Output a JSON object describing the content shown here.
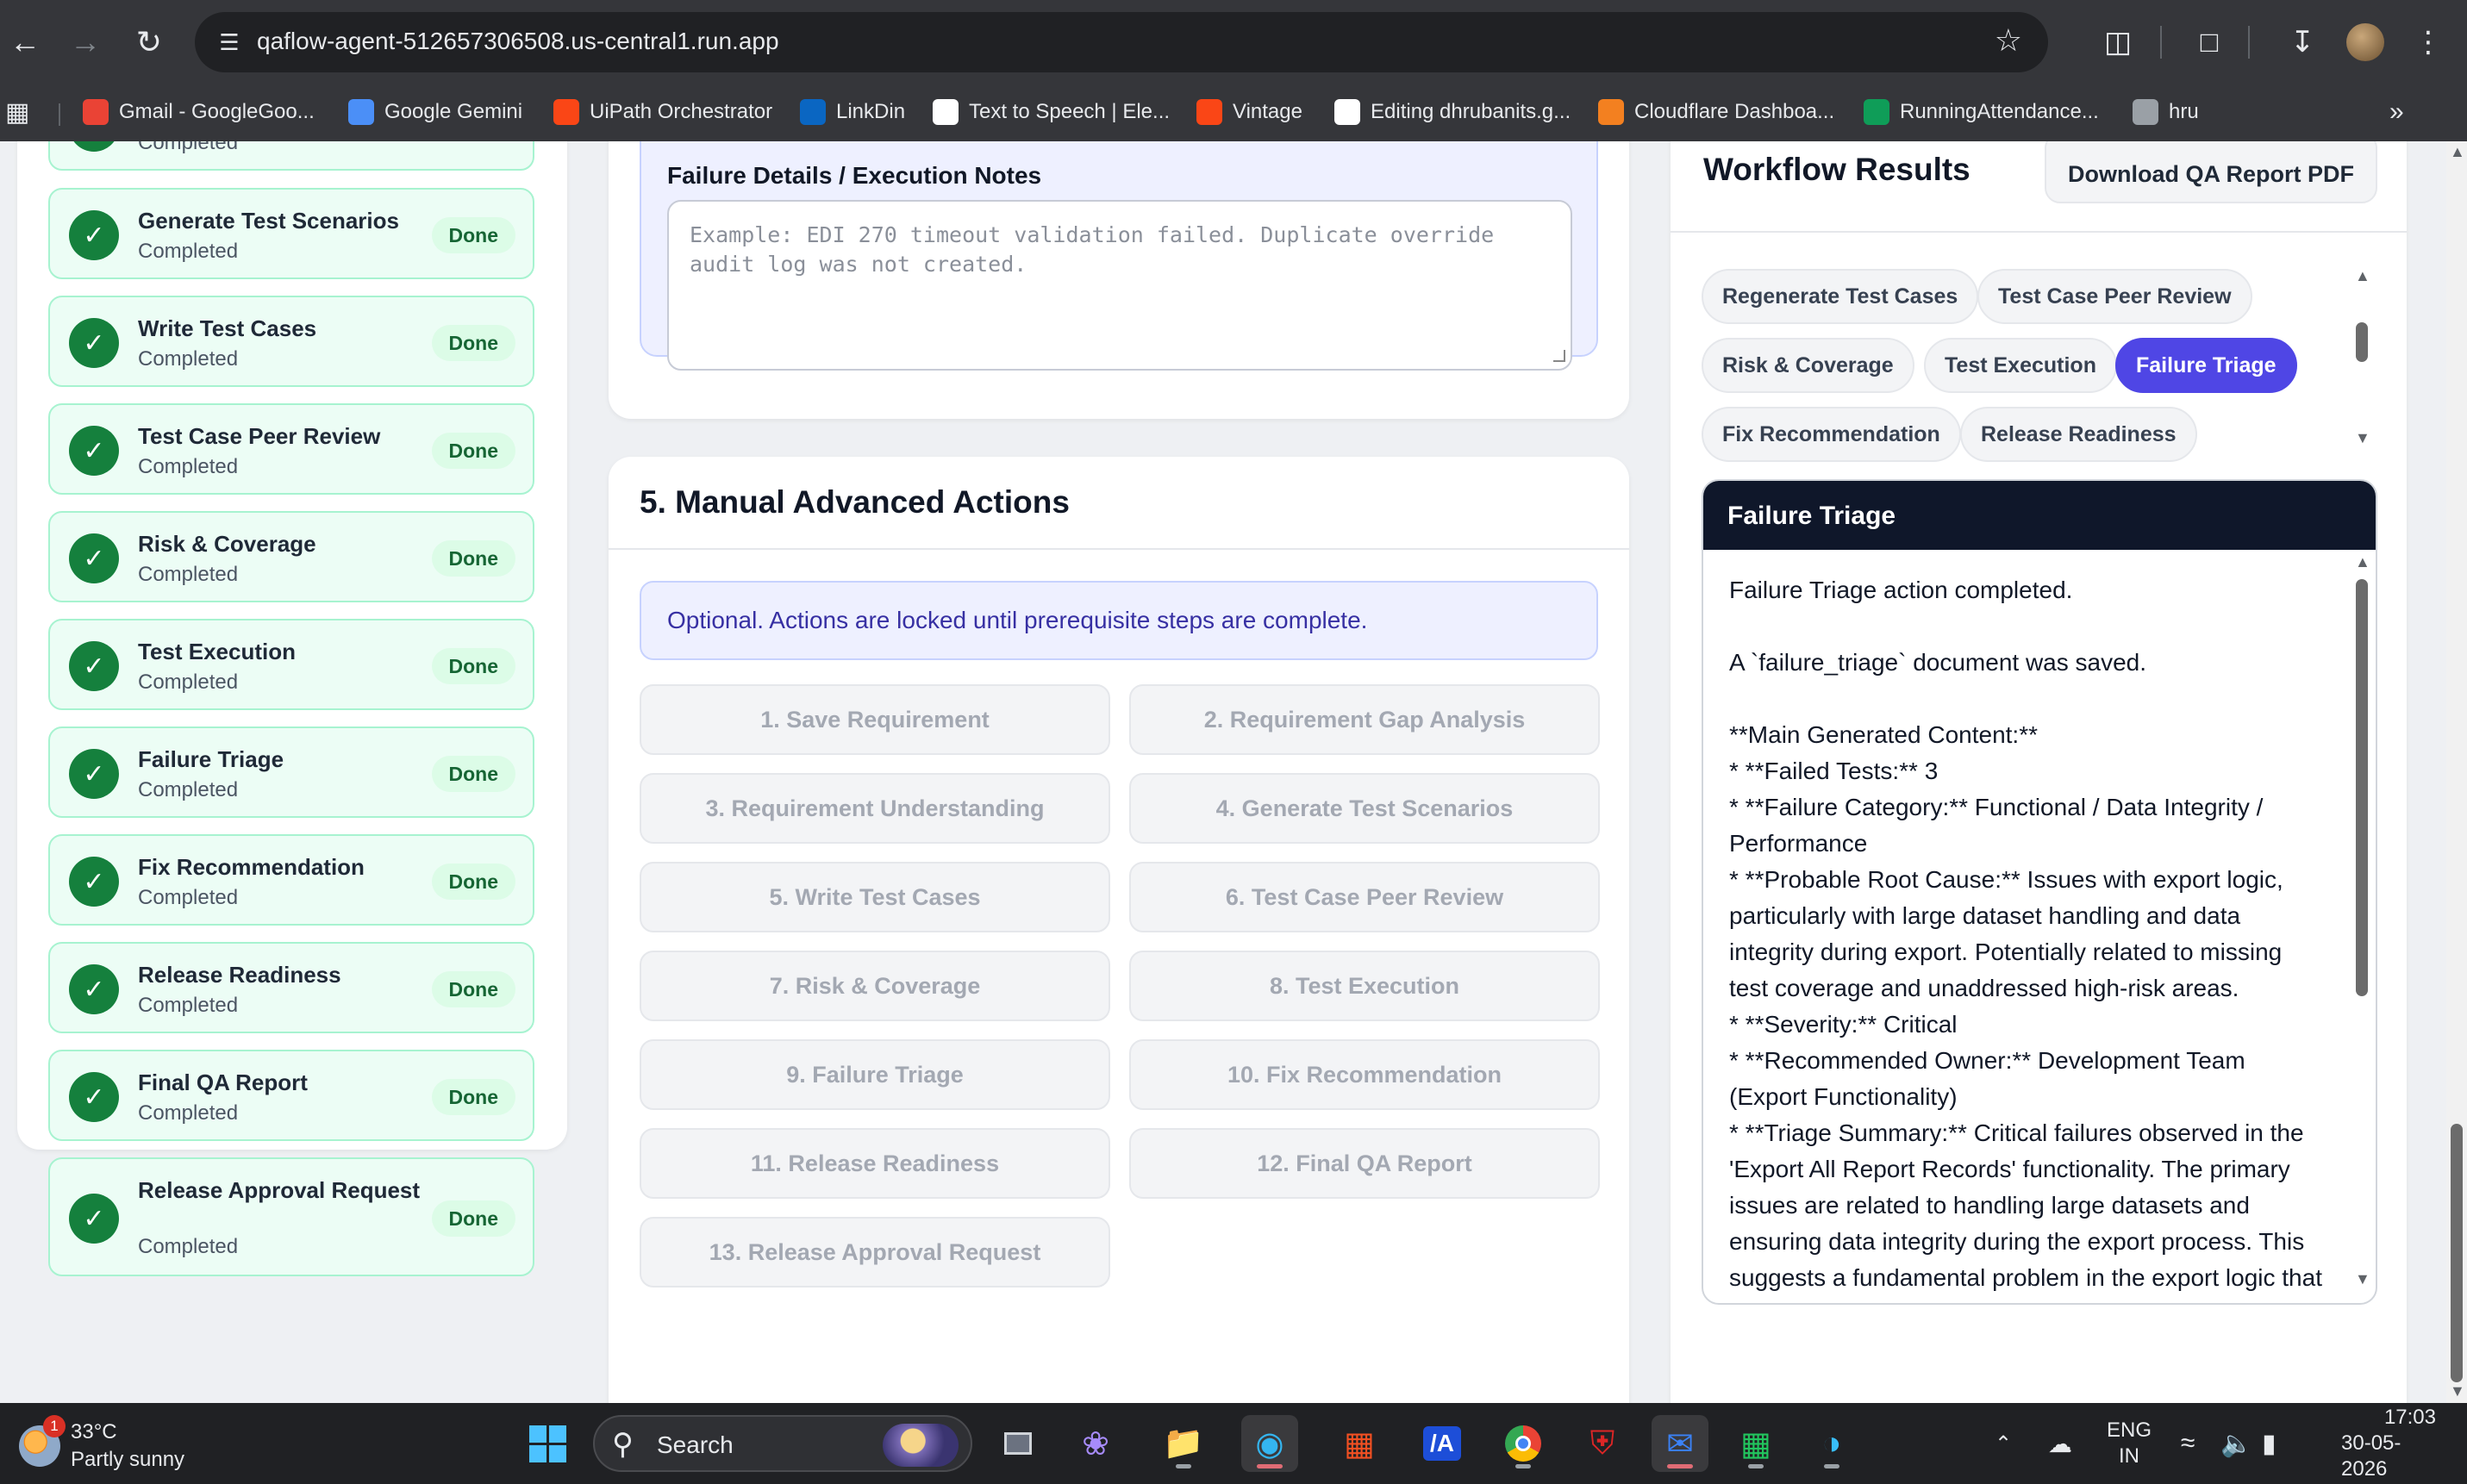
{
  "browser": {
    "url": "qaflow-agent-512657306508.us-central1.run.app",
    "bookmarks": [
      {
        "label": "Gmail - GoogleGoo...",
        "icon": "gmail-icon",
        "color": "#ea4335"
      },
      {
        "label": "Google Gemini",
        "icon": "gemini-icon",
        "color": "#4b8ff7"
      },
      {
        "label": "UiPath Orchestrator",
        "icon": "uipath-icon",
        "color": "#fa4616"
      },
      {
        "label": "LinkDin",
        "icon": "linkedin-icon",
        "color": "#0a66c2"
      },
      {
        "label": "Text to Speech | Ele...",
        "icon": "elevenlabs-icon",
        "color": "#ffffff"
      },
      {
        "label": "Vintage",
        "icon": "uipath-icon",
        "color": "#fa4616"
      },
      {
        "label": "Editing dhrubanits.g...",
        "icon": "github-icon",
        "color": "#ffffff"
      },
      {
        "label": "Cloudflare Dashboa...",
        "icon": "cloudflare-icon",
        "color": "#f38020"
      },
      {
        "label": "RunningAttendance...",
        "icon": "sheets-icon",
        "color": "#0f9d58"
      },
      {
        "label": "hru",
        "icon": "globe-icon",
        "color": "#9aa0a6"
      }
    ]
  },
  "steps": [
    {
      "title": "",
      "status": "Completed",
      "badge": ""
    },
    {
      "title": "Generate Test Scenarios",
      "status": "Completed",
      "badge": "Done"
    },
    {
      "title": "Write Test Cases",
      "status": "Completed",
      "badge": "Done"
    },
    {
      "title": "Test Case Peer Review",
      "status": "Completed",
      "badge": "Done"
    },
    {
      "title": "Risk & Coverage",
      "status": "Completed",
      "badge": "Done"
    },
    {
      "title": "Test Execution",
      "status": "Completed",
      "badge": "Done"
    },
    {
      "title": "Failure Triage",
      "status": "Completed",
      "badge": "Done"
    },
    {
      "title": "Fix Recommendation",
      "status": "Completed",
      "badge": "Done"
    },
    {
      "title": "Release Readiness",
      "status": "Completed",
      "badge": "Done"
    },
    {
      "title": "Final QA Report",
      "status": "Completed",
      "badge": "Done"
    },
    {
      "title": "Release Approval Request",
      "status": "Completed",
      "badge": "Done"
    }
  ],
  "notes": {
    "label": "Failure Details / Execution Notes",
    "placeholder": "Example: EDI 270 timeout validation failed. Duplicate override audit log was not created."
  },
  "manual": {
    "title": "5. Manual Advanced Actions",
    "info": "Optional. Actions are locked until prerequisite steps are complete.",
    "actions": [
      "1. Save Requirement",
      "2. Requirement Gap Analysis",
      "3. Requirement Understanding",
      "4. Generate Test Scenarios",
      "5. Write Test Cases",
      "6. Test Case Peer Review",
      "7. Risk & Coverage",
      "8. Test Execution",
      "9. Failure Triage",
      "10. Fix Recommendation",
      "11. Release Readiness",
      "12. Final QA Report",
      "13. Release Approval Request"
    ]
  },
  "results": {
    "title": "Workflow Results",
    "download_label": "Download QA Report PDF",
    "chips": [
      {
        "label": "Regenerate Test Cases",
        "active": false
      },
      {
        "label": "Test Case Peer Review",
        "active": false
      },
      {
        "label": "Risk & Coverage",
        "active": false
      },
      {
        "label": "Test Execution",
        "active": false
      },
      {
        "label": "Failure Triage",
        "active": true
      },
      {
        "label": "Fix Recommendation",
        "active": false
      },
      {
        "label": "Release Readiness",
        "active": false
      }
    ],
    "output_title": "Failure Triage",
    "output_lines": [
      "Failure Triage action completed.",
      "",
      "A `failure_triage` document was saved.",
      "",
      "**Main Generated Content:**",
      "*   **Failed Tests:** 3",
      "*   **Failure Category:** Functional / Data Integrity / Performance",
      "*   **Probable Root Cause:** Issues with export logic, particularly with large dataset handling and data integrity during export. Potentially related to missing test coverage and unaddressed high-risk areas.",
      "*   **Severity:** Critical",
      "*   **Recommended Owner:** Development Team (Export Functionality)",
      "*   **Triage Summary:** Critical failures observed in the 'Export All Report Records' functionality. The primary issues are related to handling large datasets and ensuring data integrity during the export process. This suggests a fundamental problem in the export logic that"
    ]
  },
  "taskbar": {
    "weather_temp": "33°C",
    "weather_desc": "Partly sunny",
    "weather_badge": "1",
    "search_label": "Search",
    "lang_top": "ENG",
    "lang_bottom": "IN",
    "time": "17:03",
    "date": "30-05-2026"
  }
}
